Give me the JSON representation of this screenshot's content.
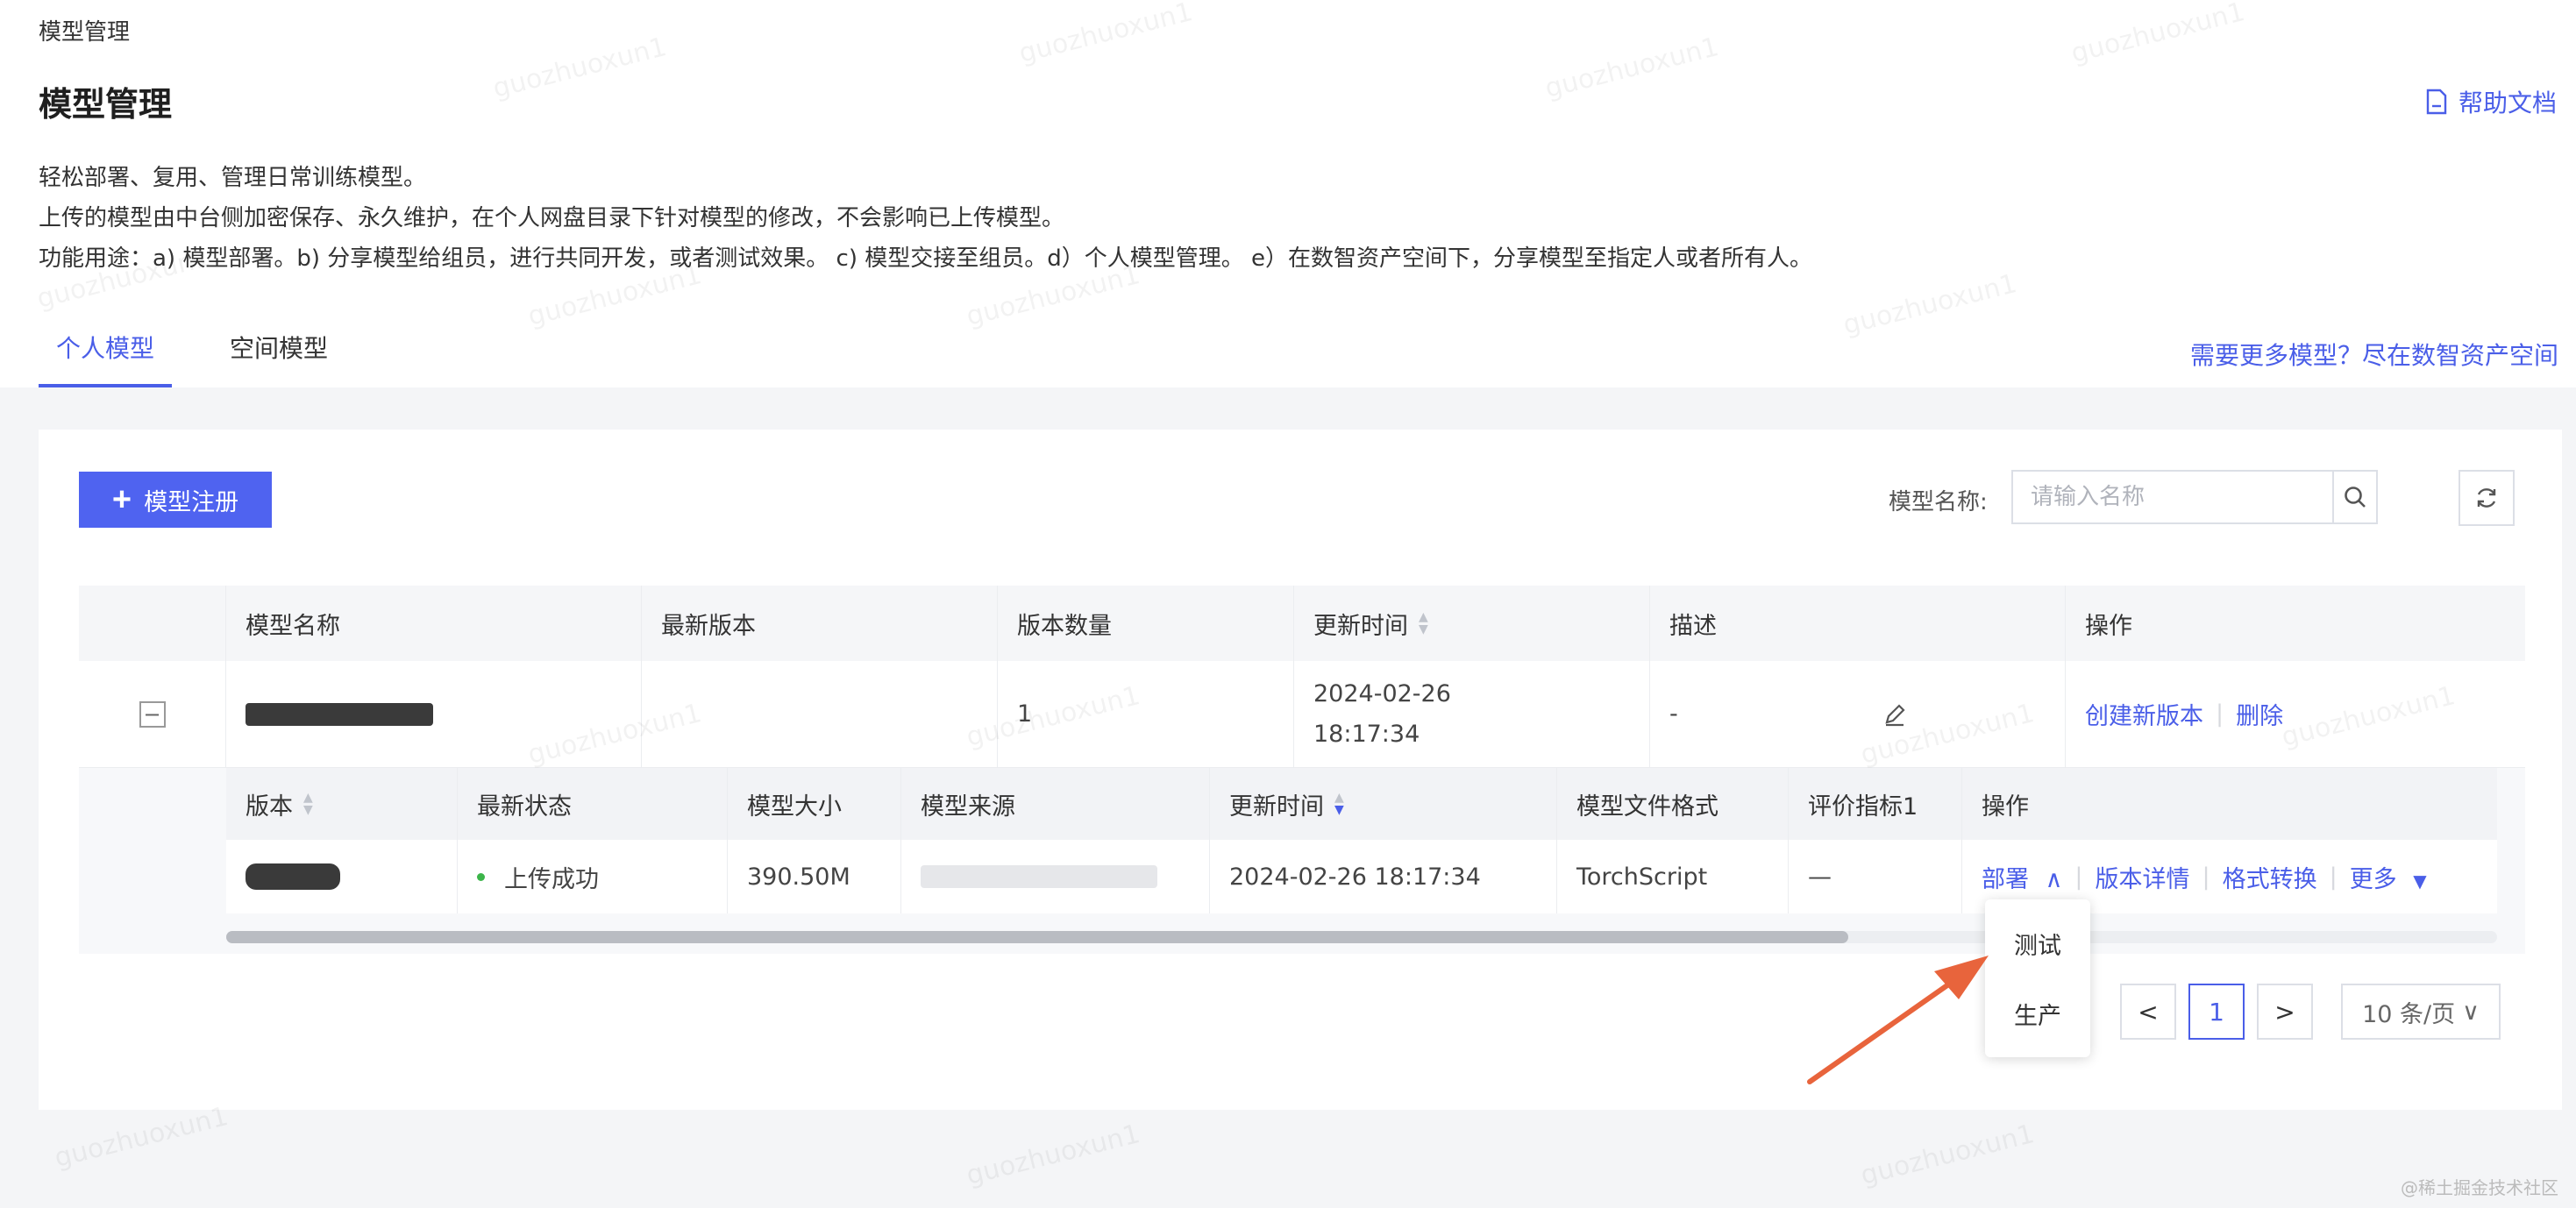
{
  "breadcrumb": "模型管理",
  "page_title": "模型管理",
  "help_link": "帮助文档",
  "description": [
    "轻松部署、复用、管理日常训练模型。",
    "上传的模型由中台侧加密保存、永久维护，在个人网盘目录下针对模型的修改，不会影响已上传模型。",
    "功能用途：a) 模型部署。b) 分享模型给组员，进行共同开发，或者测试效果。 c) 模型交接至组员。d）个人模型管理。 e）在数智资产空间下，分享模型至指定人或者所有人。"
  ],
  "tabs": [
    {
      "label": "个人模型",
      "active": true
    },
    {
      "label": "空间模型",
      "active": false
    }
  ],
  "more_models_link": "需要更多模型？尽在数智资产空间",
  "toolbar": {
    "register_button": "模型注册",
    "search_label": "模型名称:",
    "search_placeholder": "请输入名称",
    "search_value": ""
  },
  "table": {
    "columns": [
      "模型名称",
      "最新版本",
      "版本数量",
      "更新时间",
      "描述",
      "操作"
    ],
    "rows": [
      {
        "expanded": true,
        "name_redacted": true,
        "latest_version": "",
        "version_count": "1",
        "updated_date": "2024-02-26",
        "updated_time": "18:17:34",
        "description": "-",
        "actions": [
          "创建新版本",
          "删除"
        ]
      }
    ]
  },
  "sub_table": {
    "columns": [
      "版本",
      "最新状态",
      "模型大小",
      "模型来源",
      "更新时间",
      "模型文件格式",
      "评价指标1",
      "操作"
    ],
    "rows": [
      {
        "version_redacted": true,
        "status": "上传成功",
        "size": "390.50M",
        "source_redacted": true,
        "updated": "2024-02-26 18:17:34",
        "format": "TorchScript",
        "metric": "—",
        "actions": [
          "部署",
          "版本详情",
          "格式转换",
          "更多"
        ]
      }
    ]
  },
  "deploy_menu": [
    "测试",
    "生产"
  ],
  "pagination": {
    "current_page": "1",
    "page_size": "10 条/页"
  },
  "watermark_text": "guozhuoxun1",
  "footer_mark": "@稀土掘金技术社区",
  "colors": {
    "accent": "#4a5ee8",
    "button": "#4f63f0",
    "success": "#3cb54a",
    "arrow": "#e8643c"
  }
}
